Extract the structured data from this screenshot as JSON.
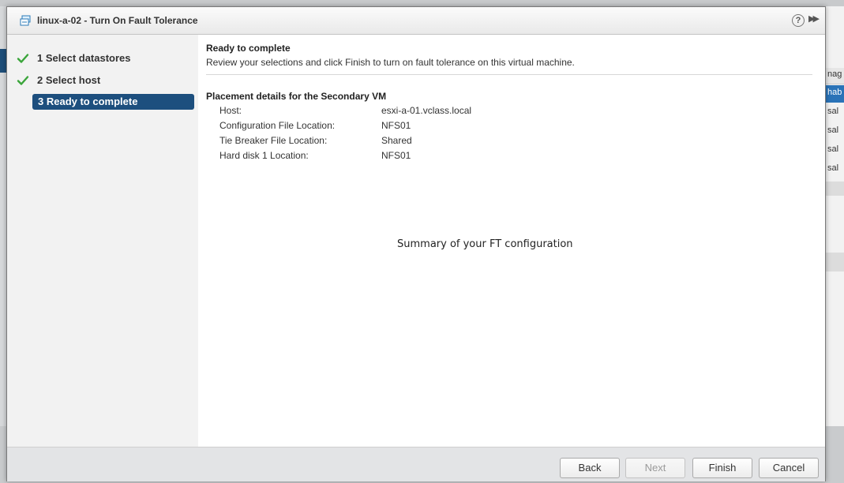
{
  "dialog": {
    "title": "linux-a-02 - Turn On Fault Tolerance",
    "help_label": "?",
    "expand_label": "▶▶"
  },
  "steps": [
    {
      "label": "1  Select datastores",
      "completed": true,
      "active": false
    },
    {
      "label": "2  Select host",
      "completed": true,
      "active": false
    },
    {
      "label": "3  Ready to complete",
      "completed": false,
      "active": true
    }
  ],
  "content": {
    "title": "Ready to complete",
    "description": "Review your selections and click Finish to turn on fault tolerance on this virtual machine.",
    "section_title": "Placement details for the Secondary VM",
    "details": [
      {
        "key": "Host:",
        "value": "esxi-a-01.vclass.local"
      },
      {
        "key": "Configuration File Location:",
        "value": "NFS01"
      },
      {
        "key": "Tie Breaker File Location:",
        "value": "Shared"
      },
      {
        "key": "Hard disk 1 Location:",
        "value": "NFS01"
      }
    ],
    "annotation": "Summary of your FT configuration"
  },
  "footer": {
    "back_label": "Back",
    "next_label": "Next",
    "finish_label": "Finish",
    "cancel_label": "Cancel"
  },
  "background": {
    "fragments": [
      "nag",
      "hab",
      "sal",
      "sal",
      "sal",
      "sal"
    ]
  },
  "colors": {
    "active_step": "#1d4f7e",
    "check": "#3aa53a",
    "accent": "#1e4e79"
  }
}
